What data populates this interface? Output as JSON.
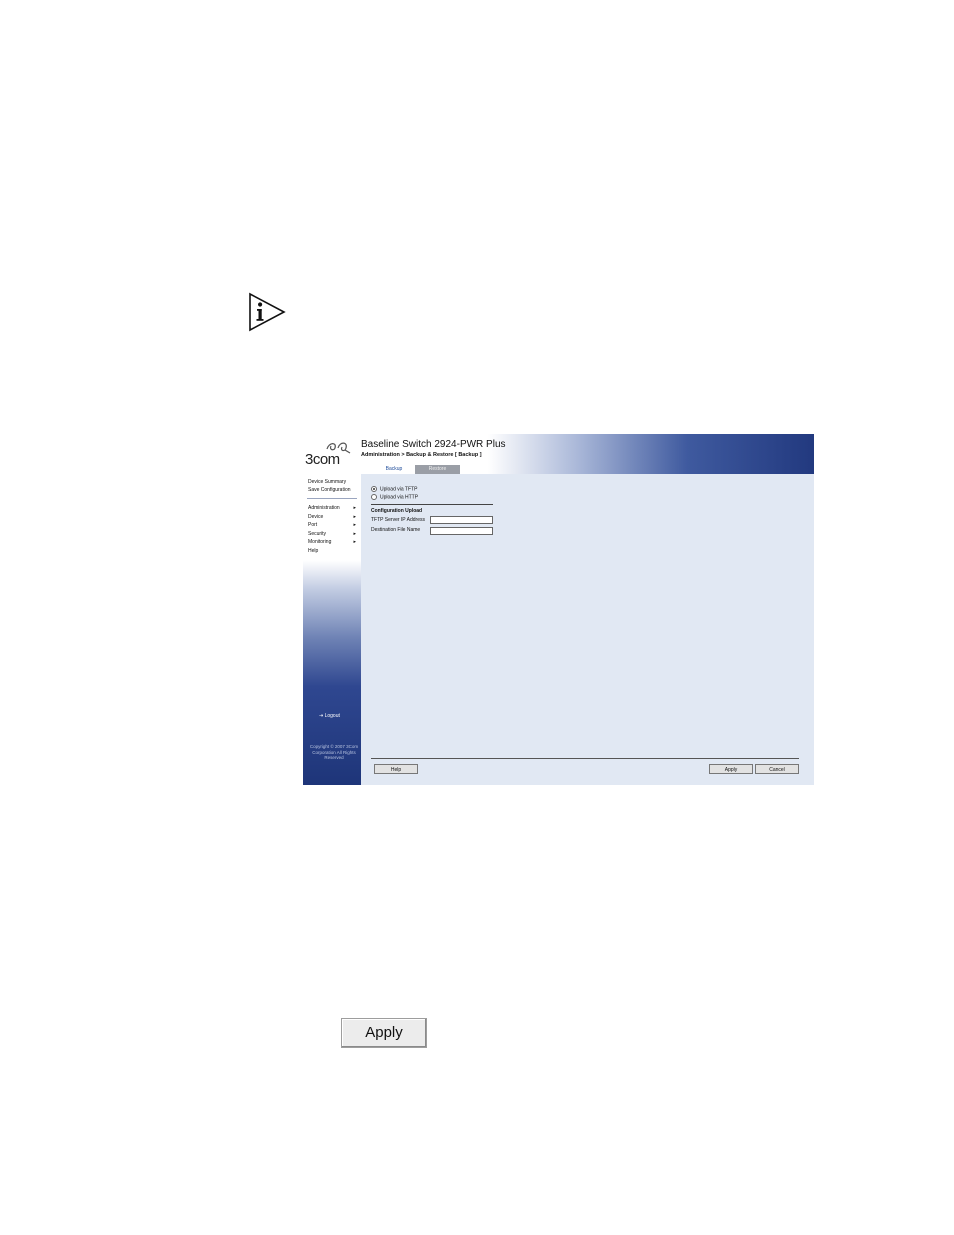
{
  "header": {
    "product_title": "Baseline Switch 2924-PWR Plus",
    "breadcrumb": "Administration > Backup & Restore [ Backup ]"
  },
  "logo": {
    "text": "3com"
  },
  "sidebar": {
    "quick_links": [
      "Device Summary",
      "Save Configuration"
    ],
    "menu": [
      {
        "label": "Administration",
        "has_submenu": true
      },
      {
        "label": "Device",
        "has_submenu": true
      },
      {
        "label": "Port",
        "has_submenu": true
      },
      {
        "label": "Security",
        "has_submenu": true
      },
      {
        "label": "Monitoring",
        "has_submenu": true
      },
      {
        "label": "Help",
        "has_submenu": false
      }
    ],
    "logout": "Logout",
    "copyright": "Copyright © 2007 3Com Corporation All Rights Reserved"
  },
  "tabs": [
    {
      "label": "Backup",
      "active": true
    },
    {
      "label": "Restore",
      "active": false
    }
  ],
  "form": {
    "upload_options": [
      {
        "label": "Upload via TFTP",
        "selected": true
      },
      {
        "label": "Upload via HTTP",
        "selected": false
      }
    ],
    "section_title": "Configuration Upload",
    "fields": [
      {
        "label": "TFTP Server IP Address",
        "value": ""
      },
      {
        "label": "Destination File Name",
        "value": ""
      }
    ]
  },
  "buttons": {
    "help": "Help",
    "apply": "Apply",
    "cancel": "Cancel"
  },
  "standalone_button": {
    "label": "Apply"
  },
  "icons": {
    "note": "info-icon",
    "menu_arrow": "triangle-right-icon",
    "logout": "logout-icon",
    "logo": "3com-swirl-icon"
  },
  "colors": {
    "header_blue": "#22397f",
    "sidebar_blue": "#1e3579",
    "content_bg": "#e1e8f3",
    "active_tab_text": "#1d4b9a"
  }
}
